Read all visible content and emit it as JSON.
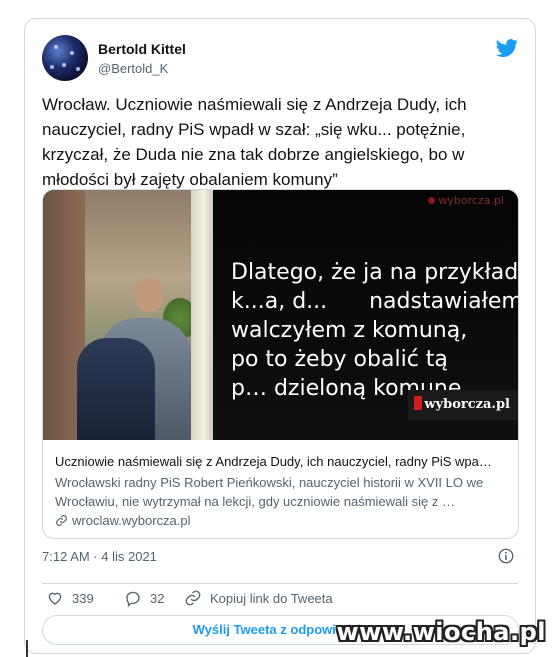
{
  "author": {
    "name": "Bertold Kittel",
    "handle": "@Bertold_K"
  },
  "tweet": {
    "text": "Wrocław. Uczniowie naśmiewali się z Andrzeja Dudy, ich nauczyciel, radny PiS wpadł w szał: „się wku... potężnie, krzyczał, że Duda nie zna tak dobrze angielskiego, bo w młodości był zajęty obalaniem komuny”",
    "timestamp": "7:12 AM · 4 lis 2021"
  },
  "media": {
    "subtitle_lines": [
      "Dlatego, że ja na przykład,",
      "k...a, d...      nadstawiałem,",
      "walczyłem z komuną,",
      "po to żeby obalić tą",
      "p… dzieloną komunę"
    ],
    "top_watermark": "wyborcza.pl",
    "logo": "wyborcza.pl"
  },
  "link_card": {
    "title": "Uczniowie naśmiewali się z Andrzeja Dudy, ich nauczyciel, radny PiS wpa…",
    "description": "Wrocławski radny PiS Robert Pieńkowski, nauczyciel historii w XVII LO we Wrocławiu, nie wytrzymał na lekcji, gdy uczniowie naśmiewali się z …",
    "domain": "wroclaw.wyborcza.pl"
  },
  "actions": {
    "likes": "339",
    "replies": "32",
    "copy_link": "Kopiuj link do Tweeta"
  },
  "reply_button": "Wyślij Tweeta z odpowiedzią",
  "site_watermark": "www.wiocha.pl",
  "colors": {
    "accent": "#1d9bf0",
    "text": "#0f1419",
    "muted": "#536471",
    "border": "#cfd9de"
  },
  "icons": [
    "twitter-bird-icon",
    "info-icon",
    "heart-icon",
    "reply-icon",
    "link-icon"
  ]
}
